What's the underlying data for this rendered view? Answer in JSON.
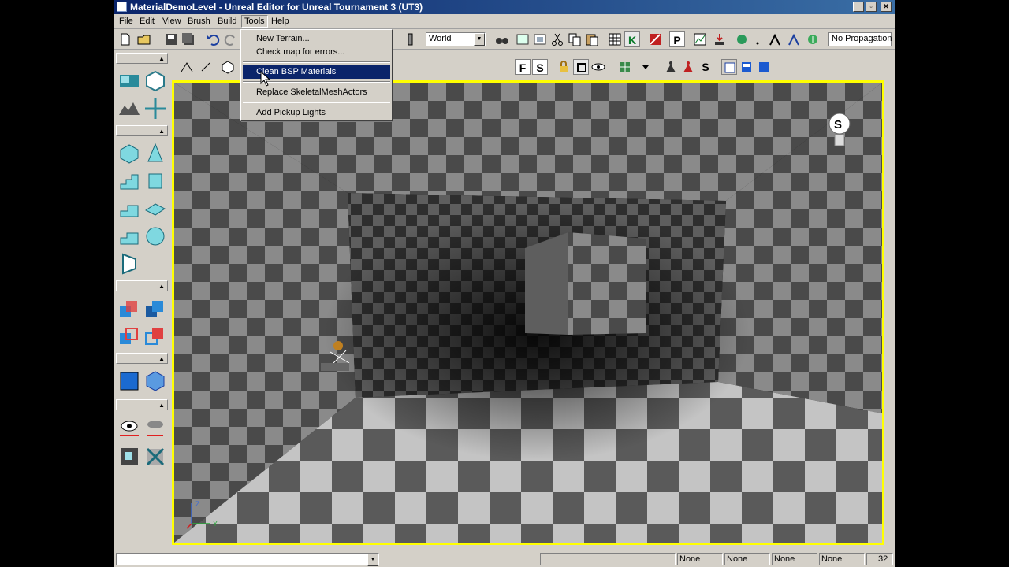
{
  "window": {
    "title": "MaterialDemoLevel - Unreal Editor for Unreal Tournament 3 (UT3)",
    "minimize_glyph": "_",
    "maximize_glyph": "▫",
    "close_glyph": "✕"
  },
  "menubar": {
    "items": [
      "File",
      "Edit",
      "View",
      "Brush",
      "Build",
      "Tools",
      "Help"
    ],
    "open_menu": "Tools"
  },
  "tools_menu": {
    "items": [
      {
        "label": "New Terrain..."
      },
      {
        "label": "Check map for errors..."
      },
      {
        "label": "Clean BSP Materials",
        "highlighted": true
      },
      {
        "label": "Replace SkeletalMeshActors"
      },
      {
        "label": "Add Pickup Lights"
      }
    ]
  },
  "toolbar": {
    "coordinate_system": "World",
    "propagation": "No Propagation",
    "k_label": "K",
    "p_label": "P"
  },
  "viewport_toolbar": {
    "f_label": "F",
    "s_label": "S",
    "s2_label": "S"
  },
  "viewport": {
    "actor_label": "S",
    "axis_z": "Z",
    "axis_y": "Y",
    "colors": {
      "floor_light": "#c8c8c8",
      "floor_dark": "#5a5a5a",
      "border": "#ffff00"
    }
  },
  "statusbar": {
    "fields": [
      "None",
      "None",
      "None",
      "None"
    ],
    "grid_size": "32"
  }
}
